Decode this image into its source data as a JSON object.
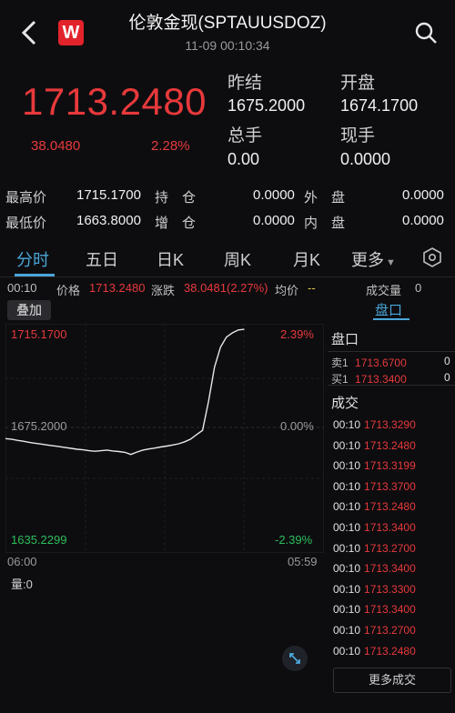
{
  "header": {
    "title": "伦敦金现(SPTAUUSDOZ)",
    "subtitle": "11-09 00:10:34",
    "logo": "W"
  },
  "quote": {
    "price": "1713.2480",
    "change": "38.0480",
    "change_pct": "2.28%",
    "prev_close_label": "昨结",
    "prev_close": "1675.2000",
    "open_label": "开盘",
    "open": "1674.1700",
    "total_vol_label": "总手",
    "total_vol": "0.00",
    "now_vol_label": "现手",
    "now_vol": "0.0000"
  },
  "ohlc": {
    "high_label": "最高价",
    "high": "1715.1700",
    "low_label": "最低价",
    "low": "1663.8000",
    "hold_label": "持　仓",
    "hold": "0.0000",
    "add_label": "增　仓",
    "add": "0.0000",
    "outer_label": "外　盘",
    "outer": "0.0000",
    "inner_label": "内　盘",
    "inner": "0.0000"
  },
  "tabs": [
    "分时",
    "五日",
    "日K",
    "周K",
    "月K",
    "更多"
  ],
  "infobar": {
    "time": "00:10",
    "price_label": "价格",
    "price": "1713.2480",
    "change_label": "涨跌",
    "change": "38.0481(2.27%)",
    "avg_label": "均价",
    "avg": "--",
    "vol_label": "成交量",
    "vol": "0"
  },
  "overlay_label": "叠加",
  "pankou_tab": "盘口",
  "chart_labels": {
    "top": "1715.1700",
    "top_pct": "2.39%",
    "mid": "1675.2000",
    "mid_pct": "0.00%",
    "bottom": "1635.2299",
    "bottom_pct": "-2.39%",
    "time_start": "06:00",
    "time_end": "05:59",
    "vol_label": "量:0"
  },
  "chart_data": {
    "type": "line",
    "ylim": [
      1635.2299,
      1715.17
    ],
    "reference": 1675.2,
    "values": [
      1675.1,
      1674.9,
      1674.5,
      1674.2,
      1673.8,
      1673.5,
      1673.2,
      1672.9,
      1672.6,
      1672.3,
      1672.0,
      1671.7,
      1671.4,
      1671.2,
      1670.9,
      1670.7,
      1670.9,
      1671.1,
      1670.8,
      1670.6,
      1670.3,
      1669.6,
      1670.4,
      1671.1,
      1671.5,
      1671.8,
      1672.2,
      1672.5,
      1672.9,
      1673.3,
      1674.0,
      1674.9,
      1676.5,
      1678.0,
      1688.0,
      1700.0,
      1707.0,
      1710.5,
      1712.0,
      1713.0,
      1713.25
    ]
  },
  "right_panel": {
    "title": "盘口",
    "sell_label": "卖1",
    "sell_price": "1713.6700",
    "sell_vol": "0",
    "buy_label": "买1",
    "buy_price": "1713.3400",
    "buy_vol": "0",
    "trades_title": "成交",
    "trades": [
      {
        "time": "00:10",
        "price": "1713.3290"
      },
      {
        "time": "00:10",
        "price": "1713.2480"
      },
      {
        "time": "00:10",
        "price": "1713.3199"
      },
      {
        "time": "00:10",
        "price": "1713.3700"
      },
      {
        "time": "00:10",
        "price": "1713.2480"
      },
      {
        "time": "00:10",
        "price": "1713.3400"
      },
      {
        "time": "00:10",
        "price": "1713.2700"
      },
      {
        "time": "00:10",
        "price": "1713.3400"
      },
      {
        "time": "00:10",
        "price": "1713.3300"
      },
      {
        "time": "00:10",
        "price": "1713.3400"
      },
      {
        "time": "00:10",
        "price": "1713.2700"
      },
      {
        "time": "00:10",
        "price": "1713.2480"
      }
    ],
    "more_label": "更多成交"
  },
  "colors": {
    "up": "#e8393b",
    "down": "#2cbf5b",
    "accent": "#4ba6d8"
  },
  "icons": {
    "back": "chevron-left-icon",
    "search": "search-icon",
    "settings": "hexagon-settings-icon",
    "expand": "expand-icon"
  }
}
